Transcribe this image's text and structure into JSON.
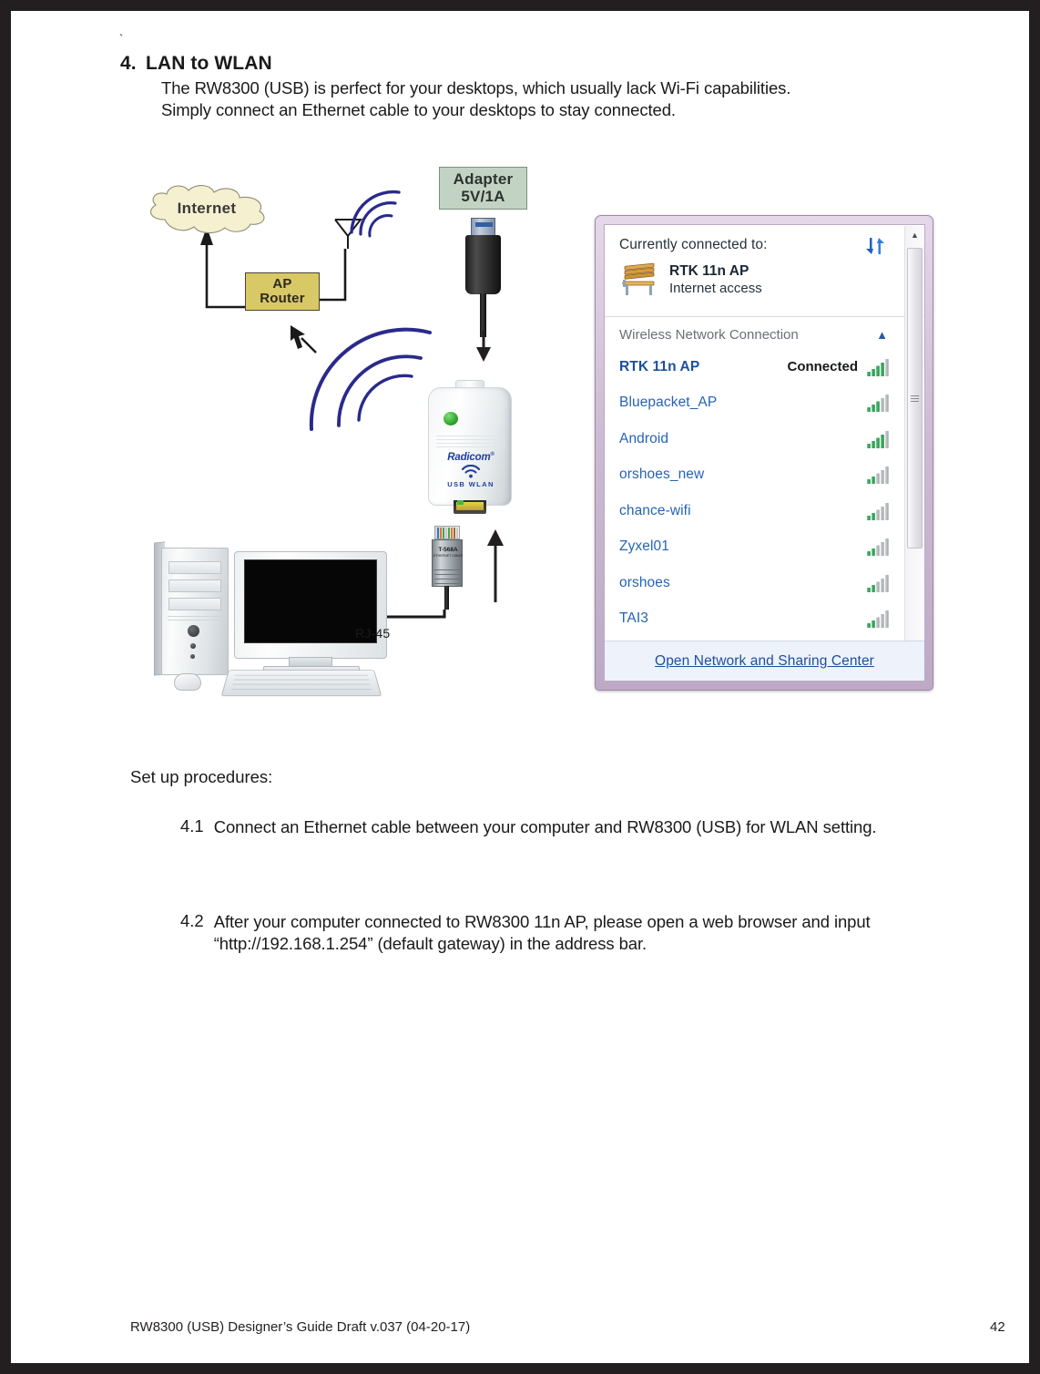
{
  "document": {
    "tick_mark": "`",
    "section_number": "4.",
    "section_title": "LAN to WLAN",
    "intro_line1": "The RW8300 (USB) is perfect for your desktops, which usually lack Wi-Fi capabilities.",
    "intro_line2": "Simply connect an Ethernet cable to your desktops to stay connected."
  },
  "diagram": {
    "cloud_label": "Internet",
    "ap_router_line1": "AP",
    "ap_router_line2": "Router",
    "adapter_line1": "Adapter",
    "adapter_line2": "5V/1A",
    "dongle_brand": "Radicom",
    "dongle_brand_mark": "®",
    "dongle_sub": "USB  WLAN",
    "rj45_plug_label": "T-568A",
    "rj45_plug_sublabel": "ETHERNET CABLE",
    "rj45_cable_label": "RJ-45",
    "colors": {
      "cloud_fill": "#F5F0D0",
      "ap_router_fill": "#D9C866",
      "adapter_fill": "#C3D3C3",
      "wave_stroke": "#2A2A8C",
      "led_green": "#2FA32B"
    }
  },
  "network_panel": {
    "header_title": "Currently connected to:",
    "refresh_icon": "refresh-icon",
    "connected_network": {
      "icon": "bench-icon",
      "ssid": "RTK 11n AP",
      "access": "Internet access"
    },
    "section_label": "Wireless Network Connection",
    "section_collapse_icon": "chevron-up-icon",
    "networks": [
      {
        "ssid": "RTK 11n AP",
        "status": "Connected",
        "bars": 4,
        "connected": true
      },
      {
        "ssid": "Bluepacket_AP",
        "status": "",
        "bars": 3,
        "connected": false
      },
      {
        "ssid": "Android",
        "status": "",
        "bars": 4,
        "connected": false
      },
      {
        "ssid": "orshoes_new",
        "status": "",
        "bars": 2,
        "connected": false
      },
      {
        "ssid": "chance-wifi",
        "status": "",
        "bars": 2,
        "connected": false
      },
      {
        "ssid": "Zyxel01",
        "status": "",
        "bars": 2,
        "connected": false
      },
      {
        "ssid": "orshoes",
        "status": "",
        "bars": 2,
        "connected": false
      },
      {
        "ssid": "TAI3",
        "status": "",
        "bars": 2,
        "connected": false
      }
    ],
    "footer_link": "Open Network and Sharing Center",
    "scrollbar": {
      "up_arrow": "▲",
      "down_arrow": "▼"
    },
    "colors": {
      "link_blue": "#2663B5",
      "frame_violet": "#CDBCD3",
      "footer_bg": "#EEF2FB",
      "signal_green": "#2E9B52",
      "signal_gray": "#AEB2B5"
    }
  },
  "procedures": {
    "heading": "Set up procedures:",
    "items": [
      {
        "number": "4.1",
        "text": "Connect an Ethernet cable between your computer and RW8300 (USB) for WLAN setting."
      },
      {
        "number": "4.2",
        "text": "After your computer connected to RW8300 11n AP, please open a web browser and input “http://192.168.1.254” (default gateway) in the address bar."
      }
    ]
  },
  "footer": {
    "left": "RW8300 (USB) Designer’s Guide Draft v.037 (04-20-17)",
    "page_number": "42"
  }
}
